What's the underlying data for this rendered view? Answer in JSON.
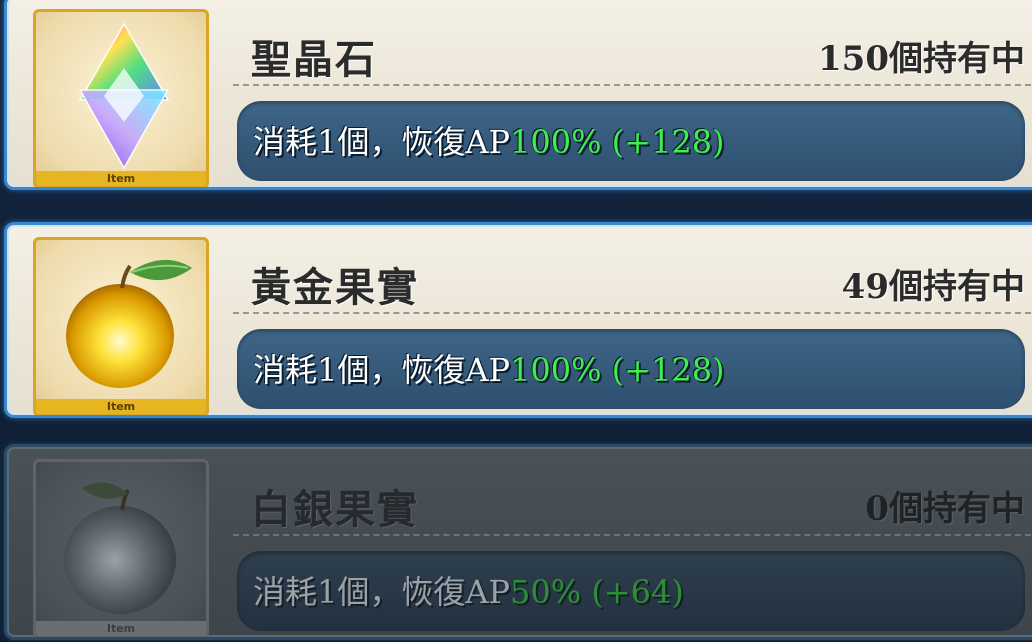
{
  "items": [
    {
      "name": "聖晶石",
      "count": "150個持有中",
      "effect_prefix": "消耗1個，恢復AP",
      "effect_value": "100% (+128)",
      "tag": "Item",
      "icon": "saint-quartz-icon"
    },
    {
      "name": "黃金果實",
      "count": "49個持有中",
      "effect_prefix": "消耗1個，恢復AP",
      "effect_value": "100% (+128)",
      "tag": "Item",
      "icon": "golden-apple-icon"
    },
    {
      "name": "白銀果實",
      "count": "0個持有中",
      "effect_prefix": "消耗1個，恢復AP",
      "effect_value": "50% (+64)",
      "tag": "Item",
      "icon": "silver-apple-icon"
    }
  ],
  "colors": {
    "frame_border": "#3a87c9",
    "gold_frame": "#d8a624",
    "effect_highlight": "#3ef04a"
  }
}
